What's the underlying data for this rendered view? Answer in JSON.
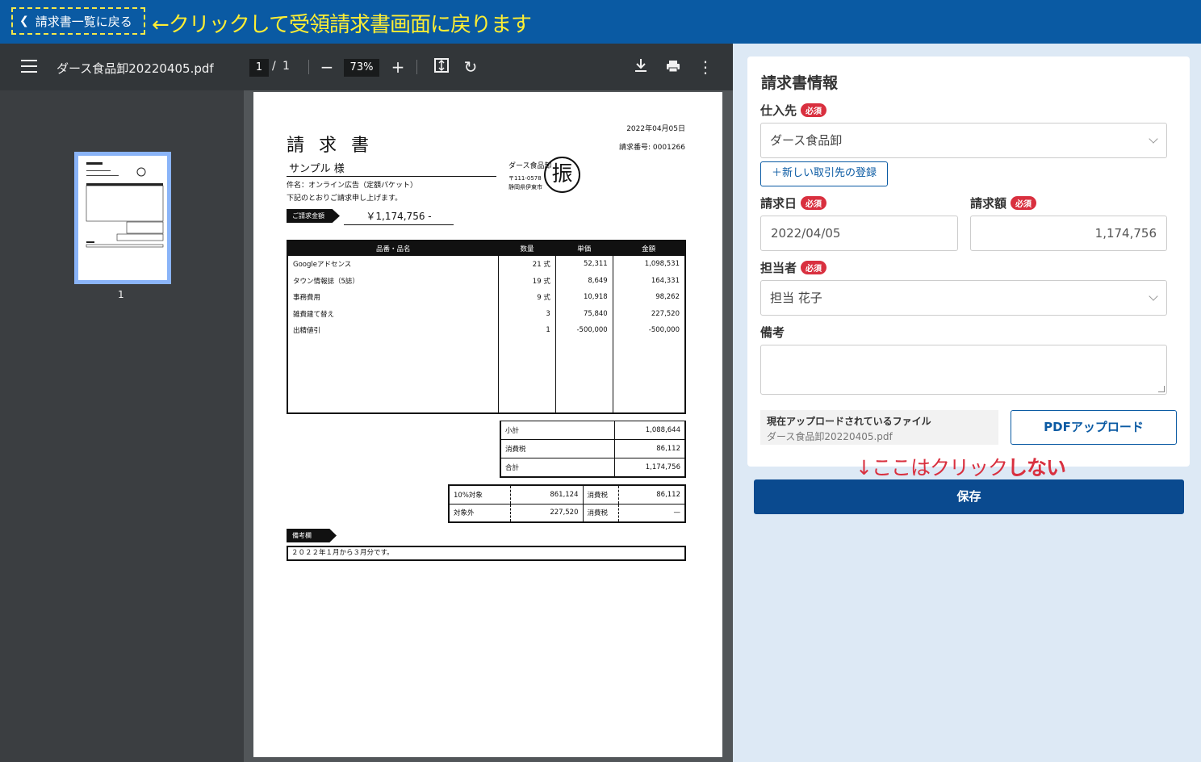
{
  "topbar": {
    "back_label": "請求書一覧に戻る",
    "annotation": "←クリックして受領請求書画面に戻ります"
  },
  "viewer": {
    "filename": "ダース食品卸20220405.pdf",
    "page_current": "1",
    "page_sep": "/",
    "page_total": "1",
    "zoom": "73%",
    "thumb_number": "1",
    "icons": [
      "menu-icon",
      "zoom-out-icon",
      "zoom-in-icon",
      "fit-page-icon",
      "rotate-icon",
      "download-icon",
      "print-icon",
      "more-icon"
    ]
  },
  "invoice": {
    "date": "2022年04月05日",
    "number": "請求番号: 0001266",
    "title": "請求書",
    "client": "サンプル 様",
    "subject": "件名：オンライン広告（定額パケット）",
    "note": "下記のとおりご請求申し上げます。",
    "amount_label": "ご請求金額",
    "amount": "￥1,174,756 -",
    "issuer": "ダース食品卸",
    "zip": "〒111-0578",
    "address": "静岡県伊東市",
    "stamp": "振",
    "headers": [
      "品番・品名",
      "数量",
      "単価",
      "金額"
    ],
    "rows": [
      {
        "name": "Googleアドセンス",
        "qty": "21 式",
        "price": "52,311",
        "amount": "1,098,531"
      },
      {
        "name": "タウン情報誌（5誌）",
        "qty": "19 式",
        "price": "8,649",
        "amount": "164,331"
      },
      {
        "name": "事務費用",
        "qty": "9 式",
        "price": "10,918",
        "amount": "98,262"
      },
      {
        "name": "雑費建て替え",
        "qty": "3",
        "price": "75,840",
        "amount": "227,520"
      },
      {
        "name": "出精値引",
        "qty": "1",
        "price": "-500,000",
        "amount": "-500,000"
      }
    ],
    "subtotal_label": "小計",
    "subtotal": "1,088,644",
    "tax_label": "消費税",
    "tax": "86,112",
    "total_label": "合計",
    "total": "1,174,756",
    "tax10_label": "10%対象",
    "tax10_base": "861,124",
    "tax10_tax_label": "消費税",
    "tax10_tax": "86,112",
    "exempt_label": "対象外",
    "exempt_base": "227,520",
    "exempt_tax_label": "消費税",
    "exempt_tax": "—",
    "remarks_label": "備考欄",
    "remarks": "２０２２年１月から３月分です。"
  },
  "form": {
    "title": "請求書情報",
    "required": "必須",
    "supplier_label": "仕入先",
    "supplier_value": "ダース食品卸",
    "new_partner": "＋新しい取引先の登録",
    "invoice_date_label": "請求日",
    "invoice_date": "2022/04/05",
    "invoice_amount_label": "請求額",
    "invoice_amount": "1,174,756",
    "person_label": "担当者",
    "person_value": "担当 花子",
    "remarks_label": "備考",
    "file_caption": "現在アップロードされているファイル",
    "file_name": "ダース食品卸20220405.pdf",
    "pdf_upload": "PDFアップロード",
    "save": "保存"
  },
  "annotation_low": {
    "part1": "↓ここはクリック",
    "part2": "しない"
  },
  "colors": {
    "brand": "#0a5aa3",
    "save": "#0a4a8f",
    "required": "#d9303f",
    "annotation_top": "#ffee33",
    "annotation_low": "#d9303f"
  }
}
